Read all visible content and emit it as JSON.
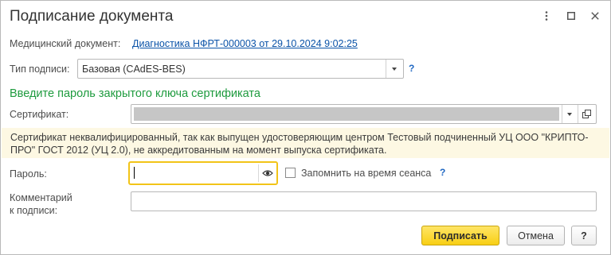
{
  "window": {
    "title": "Подписание документа",
    "more_icon": "more-vertical-icon",
    "maximize_icon": "maximize-icon",
    "close_icon": "close-icon"
  },
  "document": {
    "label": "Медицинский документ:",
    "link": "Диагностика НФРТ-000003 от 29.10.2024 9:02:25"
  },
  "signature_type": {
    "label": "Тип подписи:",
    "value": "Базовая (CAdES-BES)",
    "help": "?"
  },
  "section_title": "Введите пароль закрытого ключа сертификата",
  "certificate": {
    "label": "Сертификат:",
    "value": ""
  },
  "warning": {
    "text": "Сертификат неквалифицированный, так как выпущен удостоверяющим центром Тестовый подчиненный УЦ ООО \"КРИПТО-ПРО\" ГОСТ 2012 (УЦ 2.0), не аккредитованным на момент выпуска сертификата."
  },
  "password": {
    "label": "Пароль:",
    "value": "",
    "remember_label": "Запомнить на время сеанса",
    "remember_checked": false,
    "help": "?"
  },
  "comment": {
    "label_line1": "Комментарий",
    "label_line2": "к подписи:",
    "value": ""
  },
  "buttons": {
    "sign": "Подписать",
    "cancel": "Отмена",
    "help": "?"
  },
  "colors": {
    "accent_yellow": "#f8cf14",
    "link_blue": "#0b53a8",
    "section_green": "#1e9b3e",
    "warning_bg": "#fdf8e3"
  }
}
